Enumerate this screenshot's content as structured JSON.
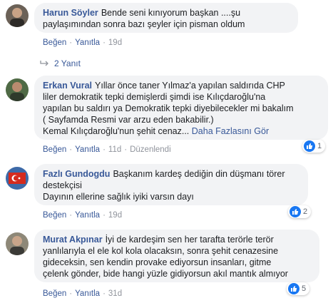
{
  "comments": [
    {
      "author": "Harun Söyler",
      "lines": [
        "Bende seni kınıyorum başkan ....şu",
        "paylaşımından sonra bazı şeyler için pisman oldum"
      ],
      "actions": {
        "like": "Beğen",
        "reply": "Yanıtla",
        "time": "19d"
      },
      "replies": "2 Yanıt"
    },
    {
      "author": "Erkan Vural",
      "lines": [
        "Yıllar önce taner Yılmaz'a yapılan saldırıda CHP",
        "liler demokratik tepki demişlerdi şimdi ise Kılıçdaroğlu'na",
        "yapılan bu saldırı ya Demokratik tepki diyebilecekler mi bakalım",
        "( Sayfamda Resmi var arzu eden bakabilir.)",
        "Kemal Kılıçdaroğlu'nun şehit cenaz..."
      ],
      "see_more": "Daha Fazlasını Gör",
      "actions": {
        "like": "Beğen",
        "reply": "Yanıtla",
        "time": "11d",
        "edited": "Düzenlendi"
      },
      "reaction_count": "1"
    },
    {
      "author": "Fazlı Gundogdu",
      "lines": [
        "Başkanım kardeş dediğin din düşmanı törer",
        "destekçisi",
        "Dayının ellerine sağlık iyiki varsın dayı"
      ],
      "actions": {
        "like": "Beğen",
        "reply": "Yanıtla",
        "time": "19d"
      },
      "reaction_count": "2"
    },
    {
      "author": "Murat Akpınar",
      "lines": [
        "İyi de kardeşim sen her tarafta terörle terör",
        "yanlılarıyla el ele kol kola olacaksın, sonra şehit cenazesine",
        "gideceksin, sen kendin provake ediyorsun insanları, gitme",
        "çelenk gönder, bide hangi yüzle gidiyorsun akıl mantık almıyor"
      ],
      "actions": {
        "like": "Beğen",
        "reply": "Yanıtla",
        "time": "31d"
      },
      "reaction_count": "5"
    }
  ]
}
